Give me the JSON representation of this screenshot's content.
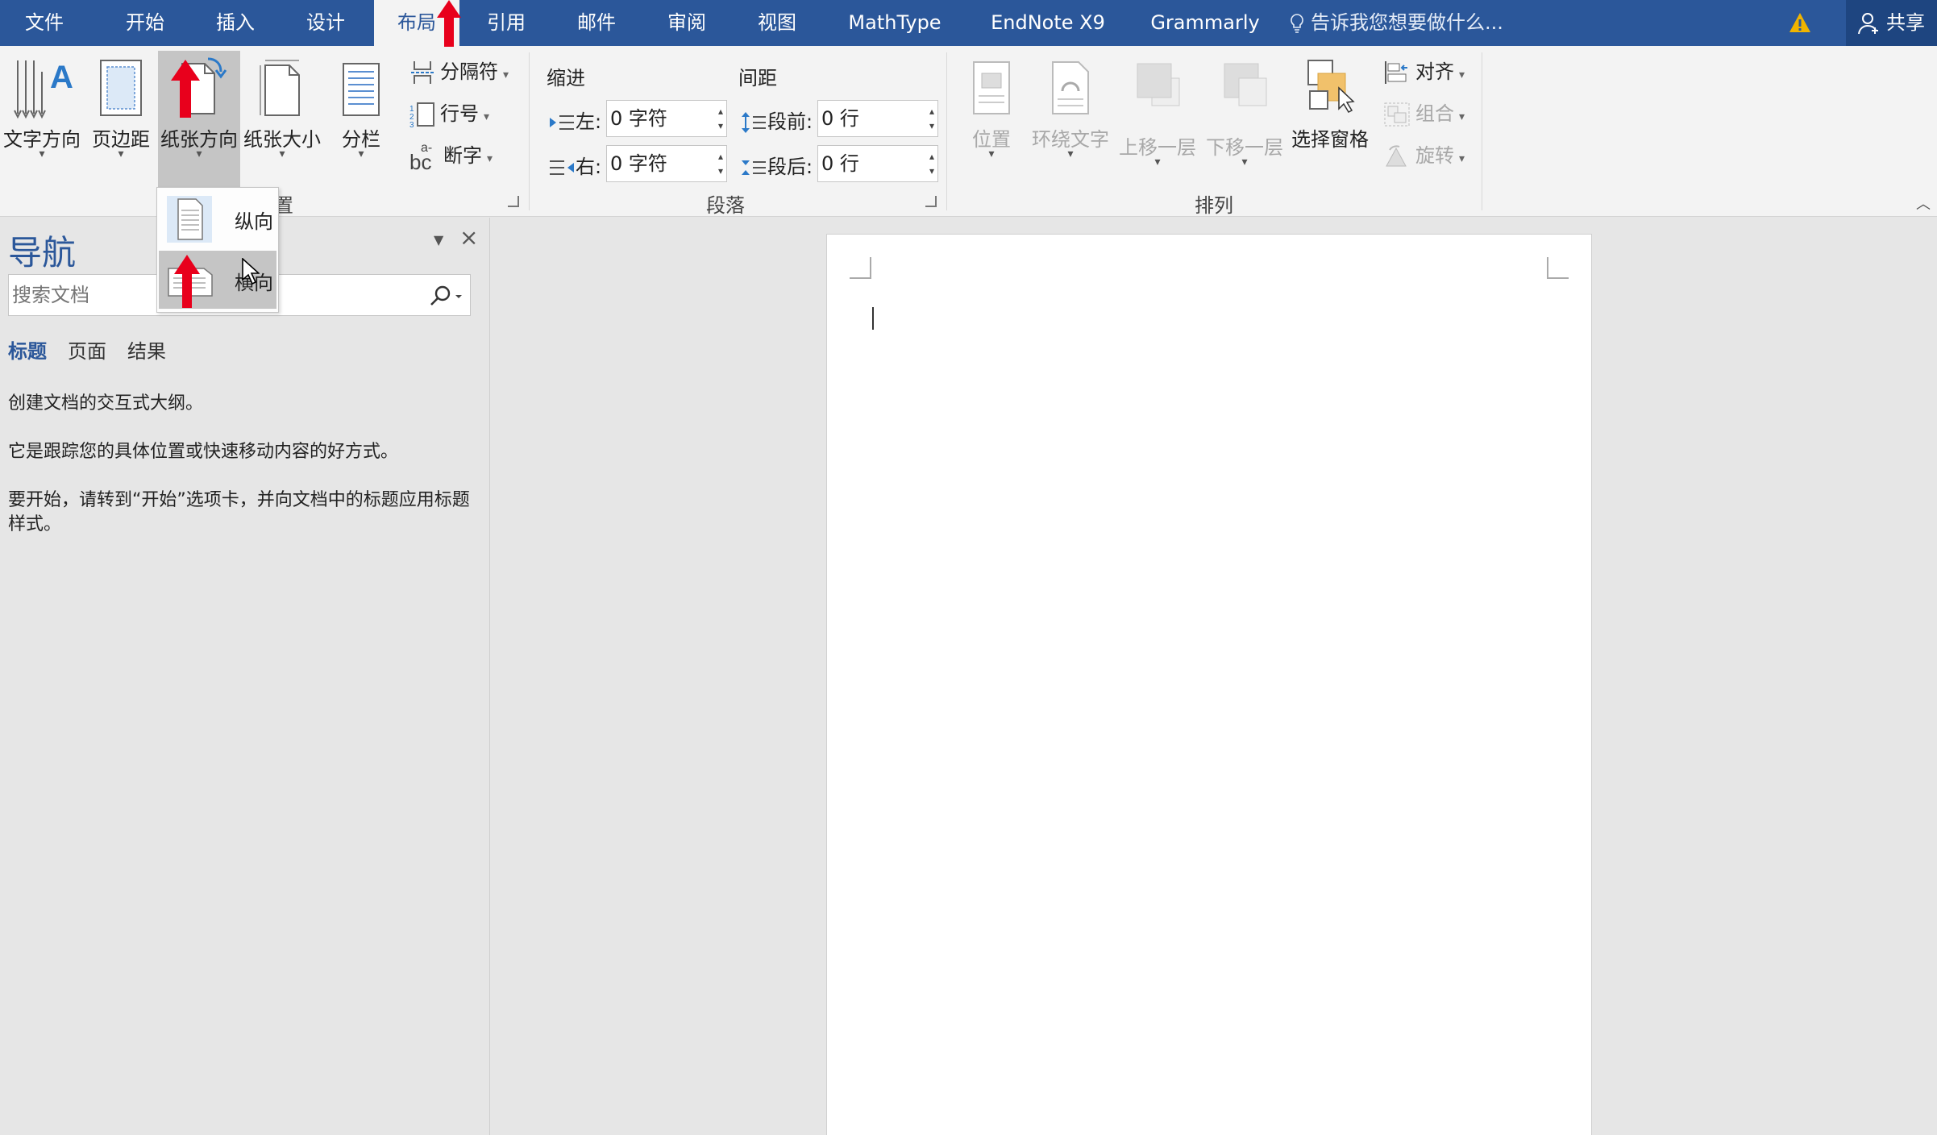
{
  "tabs": [
    {
      "label": "文件",
      "active": false
    },
    {
      "label": "开始",
      "active": false
    },
    {
      "label": "插入",
      "active": false
    },
    {
      "label": "设计",
      "active": false
    },
    {
      "label": "布局",
      "active": true
    },
    {
      "label": "引用",
      "active": false
    },
    {
      "label": "邮件",
      "active": false
    },
    {
      "label": "审阅",
      "active": false
    },
    {
      "label": "视图",
      "active": false
    },
    {
      "label": "MathType",
      "active": false
    },
    {
      "label": "EndNote X9",
      "active": false
    },
    {
      "label": "Grammarly",
      "active": false
    }
  ],
  "tell_me": "告诉我您想要做什么...",
  "share_label": "共享",
  "ribbon": {
    "page_setup": {
      "text_direction": "文字方向",
      "margins": "页边距",
      "orientation": "纸张方向",
      "size": "纸张大小",
      "columns": "分栏",
      "breaks": "分隔符",
      "line_numbers": "行号",
      "hyphenation": "断字",
      "label_partial": "置"
    },
    "paragraph": {
      "indent_header": "缩进",
      "spacing_header": "间距",
      "left_label": "左:",
      "left_value": "0 字符",
      "right_label": "右:",
      "right_value": "0 字符",
      "before_label": "段前:",
      "before_value": "0 行",
      "after_label": "段后:",
      "after_value": "0 行",
      "group_label": "段落"
    },
    "arrange": {
      "position": "位置",
      "wrap_text": "环绕文字",
      "bring_forward": "上移一层",
      "send_backward": "下移一层",
      "selection_pane": "选择窗格",
      "align": "对齐",
      "group": "组合",
      "rotate": "旋转",
      "group_label": "排列"
    }
  },
  "orientation_menu": {
    "portrait": "纵向",
    "landscape": "横向",
    "hovered": "landscape"
  },
  "nav_pane": {
    "title": "导航",
    "search_placeholder": "搜索文档",
    "tabs": [
      "标题",
      "页面",
      "结果"
    ],
    "active_tab": "标题",
    "text1": "创建文档的交互式大纲。",
    "text2": "它是跟踪您的具体位置或快速移动内容的好方式。",
    "text3": "要开始，请转到“开始”选项卡，并向文档中的标题应用标题样式。"
  },
  "colors": {
    "brand": "#2b579a",
    "annotation_arrow": "#e8001c",
    "warning": "#f0b400"
  }
}
